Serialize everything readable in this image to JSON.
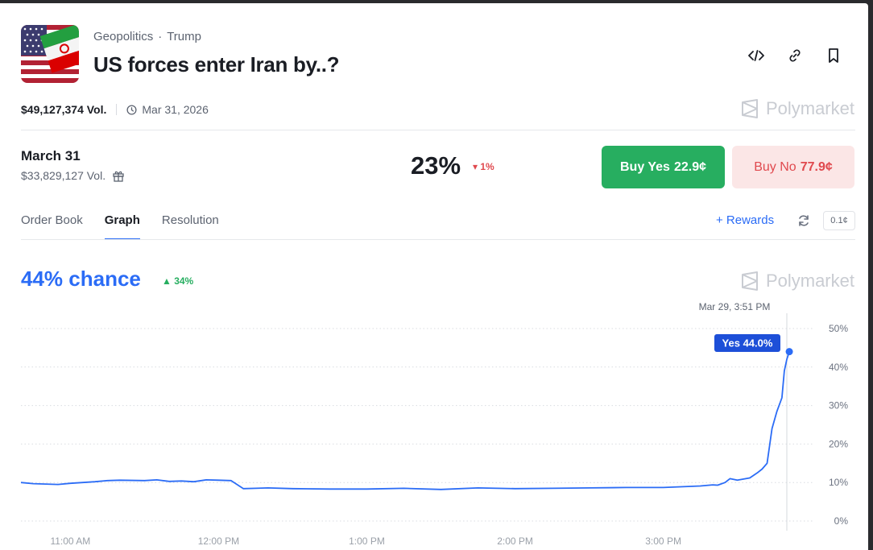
{
  "header": {
    "category": "Geopolitics",
    "tag": "Trump",
    "separator": "·",
    "title": "US forces enter Iran by..?"
  },
  "meta": {
    "volume": "$49,127,374 Vol.",
    "end_date": "Mar 31, 2026"
  },
  "brand": {
    "name": "Polymarket"
  },
  "outcome": {
    "name": "March 31",
    "volume": "$33,829,127 Vol.",
    "probability": "23%",
    "change": "▾ 1%",
    "buy_yes_label": "Buy Yes",
    "buy_yes_price": "22.9¢",
    "buy_no_label": "Buy No",
    "buy_no_price": "77.9¢"
  },
  "tabs": [
    {
      "label": "Order Book"
    },
    {
      "label": "Graph"
    },
    {
      "label": "Resolution"
    }
  ],
  "rewards": {
    "label": "+ Rewards",
    "tick_size": "0.1¢"
  },
  "graph": {
    "chance": "44% chance",
    "change": "▲ 34%",
    "hover_time": "Mar 29, 3:51 PM",
    "hover_label": "Yes 44.0%"
  },
  "colors": {
    "line": "#2b6cf6",
    "yes": "#27ae60",
    "no": "#e0494e",
    "no_bg": "#fbe6e6"
  },
  "chart_data": {
    "type": "line",
    "series": [
      {
        "name": "Yes",
        "x": [
          "10:40",
          "10:45",
          "10:55",
          "11:00",
          "11:10",
          "11:15",
          "11:20",
          "11:30",
          "11:35",
          "11:40",
          "11:45",
          "11:50",
          "11:55",
          "12:00",
          "12:05",
          "12:10",
          "12:15",
          "12:20",
          "12:30",
          "12:45",
          "1:00",
          "1:15",
          "1:30",
          "1:45",
          "2:00",
          "2:15",
          "2:30",
          "2:45",
          "3:00",
          "3:15",
          "3:20",
          "3:22",
          "3:25",
          "3:27",
          "3:30",
          "3:35",
          "3:38",
          "3:40",
          "3:42",
          "3:44",
          "3:46",
          "3:48",
          "3:49",
          "3:50",
          "3:51"
        ],
        "values": [
          10.0,
          9.7,
          9.5,
          9.8,
          10.2,
          10.5,
          10.6,
          10.5,
          10.7,
          10.3,
          10.4,
          10.2,
          10.7,
          10.6,
          10.5,
          8.4,
          8.5,
          8.6,
          8.4,
          8.3,
          8.3,
          8.5,
          8.2,
          8.6,
          8.4,
          8.5,
          8.6,
          8.7,
          8.7,
          9.1,
          9.4,
          9.3,
          10.0,
          11.0,
          10.6,
          11.2,
          12.5,
          13.5,
          15.0,
          24.0,
          28.5,
          32.0,
          39.0,
          42.0,
          44.0
        ]
      }
    ],
    "xlabels": [
      "11:00 AM",
      "12:00 PM",
      "1:00 PM",
      "2:00 PM",
      "3:00 PM"
    ],
    "yticks": [
      "50%",
      "40%",
      "30%",
      "20%",
      "10%",
      "0%"
    ],
    "ylim": [
      0,
      50
    ],
    "grid": true
  }
}
